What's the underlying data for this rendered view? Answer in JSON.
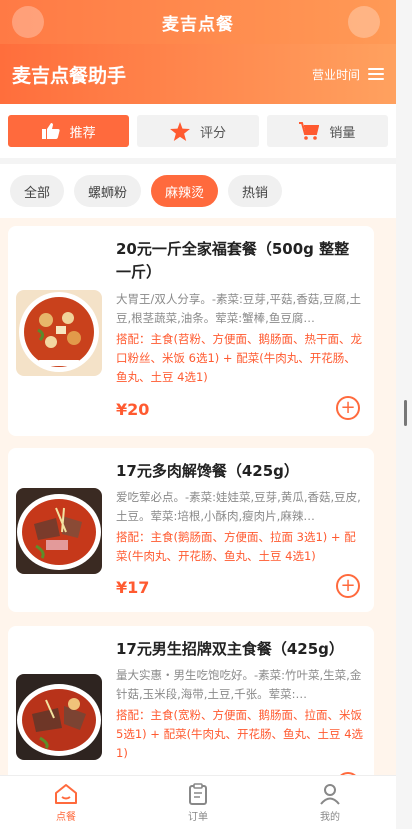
{
  "topbar": {
    "title": "麦吉点餐"
  },
  "header": {
    "app_name": "麦吉点餐助手",
    "hours_label": "营业时间"
  },
  "sort": [
    {
      "label": "推荐",
      "icon": "thumbs-up-icon",
      "active": true
    },
    {
      "label": "评分",
      "icon": "star-icon",
      "active": false
    },
    {
      "label": "销量",
      "icon": "cart-icon",
      "active": false
    }
  ],
  "categories": [
    {
      "label": "全部",
      "active": false
    },
    {
      "label": "螺蛳粉",
      "active": false
    },
    {
      "label": "麻辣烫",
      "active": true
    },
    {
      "label": "热销",
      "active": false
    }
  ],
  "products": [
    {
      "name": "20元一斤全家福套餐（500g 整整一斤）",
      "desc": "大胃王/双人分享。-素菜:豆芽,平菇,香菇,豆腐,土豆,根茎蔬菜,油条。荤菜:蟹棒,鱼豆腐…",
      "combo": "搭配：主食(苕粉、方便面、鹅肠面、热干面、龙口粉丝、米饭 6选1) + 配菜(牛肉丸、开花肠、鱼丸、土豆 4选1)",
      "price": "¥20"
    },
    {
      "name": "17元多肉解馋餐（425g）",
      "desc": "爱吃荤必点。-素菜:娃娃菜,豆芽,黄瓜,香菇,豆皮,土豆。荤菜:培根,小酥肉,瘦肉片,麻辣…",
      "combo": "搭配：主食(鹅肠面、方便面、拉面 3选1) + 配菜(牛肉丸、开花肠、鱼丸、土豆 4选1)",
      "price": "¥17"
    },
    {
      "name": "17元男生招牌双主食餐（425g）",
      "desc": "量大实惠・男生吃饱吃好。-素菜:竹叶菜,生菜,金针菇,玉米段,海带,土豆,千张。荤菜:…",
      "combo": "搭配：主食(宽粉、方便面、鹅肠面、拉面、米饭 5选1) + 配菜(牛肉丸、开花肠、鱼丸、土豆 4选1)",
      "price": ""
    }
  ],
  "tabs": [
    {
      "label": "点餐",
      "icon": "home-icon",
      "active": true
    },
    {
      "label": "订单",
      "icon": "clipboard-icon",
      "active": false
    },
    {
      "label": "我的",
      "icon": "user-icon",
      "active": false
    }
  ],
  "colors": {
    "accent": "#ff6a3d",
    "price": "#ff5a30",
    "list_bg": "#fff5ec"
  }
}
